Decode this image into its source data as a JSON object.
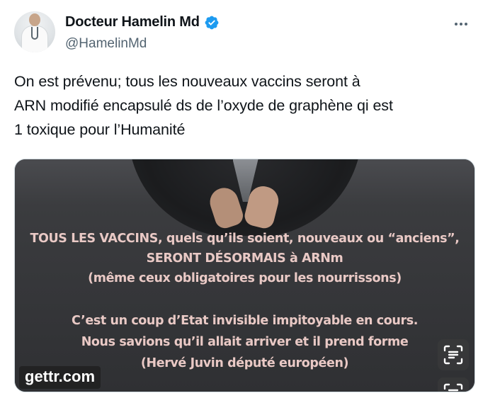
{
  "author": {
    "display_name": "Docteur Hamelin Md",
    "handle": "@HamelinMd",
    "verified_color": "#1d9bf0"
  },
  "icons": {
    "more": "more-horizontal-icon",
    "verified": "verified-badge-icon",
    "text_recognition": "text-recognition-icon"
  },
  "tweet": {
    "text_line1": "On est prévenu; tous les nouveaux vaccins seront à",
    "text_line2": "ARN modifié encapsulé ds de l’oxyde de graphène qi est",
    "text_line3": "1 toxique pour l’Humanité"
  },
  "media": {
    "line1": "TOUS LES VACCINS, quels qu’ils soient, nouveaux ou “anciens”,",
    "line2": "SERONT DÉSORMAIS à ARNm",
    "line3": "(même ceux obligatoires pour les nourrissons)",
    "line4": "C’est un coup d’Etat invisible impitoyable en cours.",
    "line5": "Nous savions qu’il allait arriver et il prend forme",
    "line6": "(Hervé Juvin député européen)",
    "watermark": "gettr.com",
    "text_color": "#e9c9c5"
  }
}
